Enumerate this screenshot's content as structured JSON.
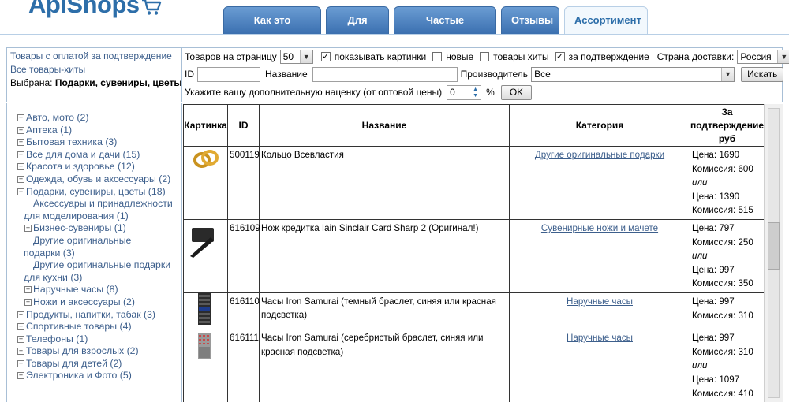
{
  "logo": {
    "text": "ApiShops"
  },
  "tabs": [
    {
      "label": "Как это работает"
    },
    {
      "label": "Для кого"
    },
    {
      "label": "Частые вопросы"
    },
    {
      "label": "Отзывы"
    },
    {
      "label": "Ассортимент",
      "active": true
    }
  ],
  "left_panel": {
    "link1": "Товары с оплатой за подтверждение",
    "link2": "Все товары-хиты",
    "selected_prefix": "Выбрана: ",
    "selected_value": "Подарки, сувениры, цветы"
  },
  "filters": {
    "per_page_label": "Товаров на страницу",
    "per_page_value": "50",
    "show_images_label": "показывать картинки",
    "show_images_checked": true,
    "new_label": "новые",
    "new_checked": false,
    "hits_label": "товары хиты",
    "hits_checked": false,
    "confirm_label": "за подтверждение",
    "confirm_checked": true,
    "country_label": "Страна доставки:",
    "country_value": "Россия",
    "id_label": "ID",
    "id_value": "",
    "name_label": "Название",
    "name_value": "",
    "maker_label": "Производитель",
    "maker_value": "Все",
    "search_button": "Искать",
    "markup_label": "Укажите вашу дополнительную наценку (от оптовой цены)",
    "markup_value": "0",
    "percent": "%",
    "ok_button": "OK"
  },
  "categories": [
    {
      "label": "Авто, мото (2)",
      "level": 0,
      "toggle": "+"
    },
    {
      "label": "Аптека (1)",
      "level": 0,
      "toggle": "+"
    },
    {
      "label": "Бытовая техника (3)",
      "level": 0,
      "toggle": "+"
    },
    {
      "label": "Все для дома и дачи (15)",
      "level": 0,
      "toggle": "+"
    },
    {
      "label": "Красота и здоровье (12)",
      "level": 0,
      "toggle": "+"
    },
    {
      "label": "Одежда, обувь и аксессуары (2)",
      "level": 0,
      "toggle": "+"
    },
    {
      "label": "Подарки, сувениры, цветы (18)",
      "level": 0,
      "toggle": "−"
    },
    {
      "label": "Аксессуары и принадлежности",
      "level": 1,
      "toggle": ""
    },
    {
      "label": "для моделирования (1)",
      "level": 2,
      "toggle": ""
    },
    {
      "label": "Бизнес-сувениры (1)",
      "level": 1,
      "toggle": "+"
    },
    {
      "label": "Другие оригинальные",
      "level": 1,
      "toggle": ""
    },
    {
      "label": "подарки (3)",
      "level": 2,
      "toggle": ""
    },
    {
      "label": "Другие оригинальные подарки",
      "level": 1,
      "toggle": ""
    },
    {
      "label": "для кухни (3)",
      "level": 2,
      "toggle": ""
    },
    {
      "label": "Наручные часы (8)",
      "level": 1,
      "toggle": "+"
    },
    {
      "label": "Ножи и аксессуары (2)",
      "level": 1,
      "toggle": "+"
    },
    {
      "label": "Продукты, напитки, табак (3)",
      "level": 0,
      "toggle": "+"
    },
    {
      "label": "Спортивные товары (4)",
      "level": 0,
      "toggle": "+"
    },
    {
      "label": "Телефоны (1)",
      "level": 0,
      "toggle": "+"
    },
    {
      "label": "Товары для взрослых (2)",
      "level": 0,
      "toggle": "+"
    },
    {
      "label": "Товары для детей (2)",
      "level": 0,
      "toggle": "+"
    },
    {
      "label": "Электроника и Фото (5)",
      "level": 0,
      "toggle": "+"
    }
  ],
  "table": {
    "headers": {
      "image": "Картинка",
      "id": "ID",
      "name": "Название",
      "category": "Категория",
      "price_1": "За",
      "price_2": "подтверждение,",
      "price_3": "руб"
    },
    "rows": [
      {
        "icon": "rings-image",
        "id": "500119",
        "name": "Кольцо Всевластия",
        "category": "Другие оригинальные подарки",
        "price": "Цена: 1690",
        "commission": "Комиссия: 600",
        "or": "или",
        "price2": "Цена: 1390",
        "commission2": "Комиссия: 515"
      },
      {
        "icon": "knife-card-image",
        "id": "616109",
        "name": "Нож кредитка Iain Sinclair Card Sharp 2 (Оригинал!)",
        "category": "Сувенирные ножи и мачете",
        "price": "Цена: 797",
        "commission": "Комиссия: 250",
        "or": "или",
        "price2": "Цена: 997",
        "commission2": "Комиссия: 350"
      },
      {
        "icon": "watch-dark-image",
        "id": "616110",
        "name": "Часы Iron Samurai (темный браслет, синяя или красная подсветка)",
        "category": "Наручные часы",
        "price": "Цена: 997",
        "commission": "Комиссия: 310",
        "or": "",
        "price2": "",
        "commission2": ""
      },
      {
        "icon": "watch-silver-image",
        "id": "616111",
        "name": "Часы Iron Samurai (серебристый браслет, синяя или красная подсветка)",
        "category": "Наручные часы",
        "price": "Цена: 997",
        "commission": "Комиссия: 310",
        "or": "или",
        "price2": "Цена: 1097",
        "commission2": "Комиссия: 410"
      }
    ]
  },
  "colors": {
    "link": "#3d5f8c",
    "tab_bg": "#3b70b0",
    "logo": "#2d6ea9",
    "border": "#a8bfd6"
  }
}
